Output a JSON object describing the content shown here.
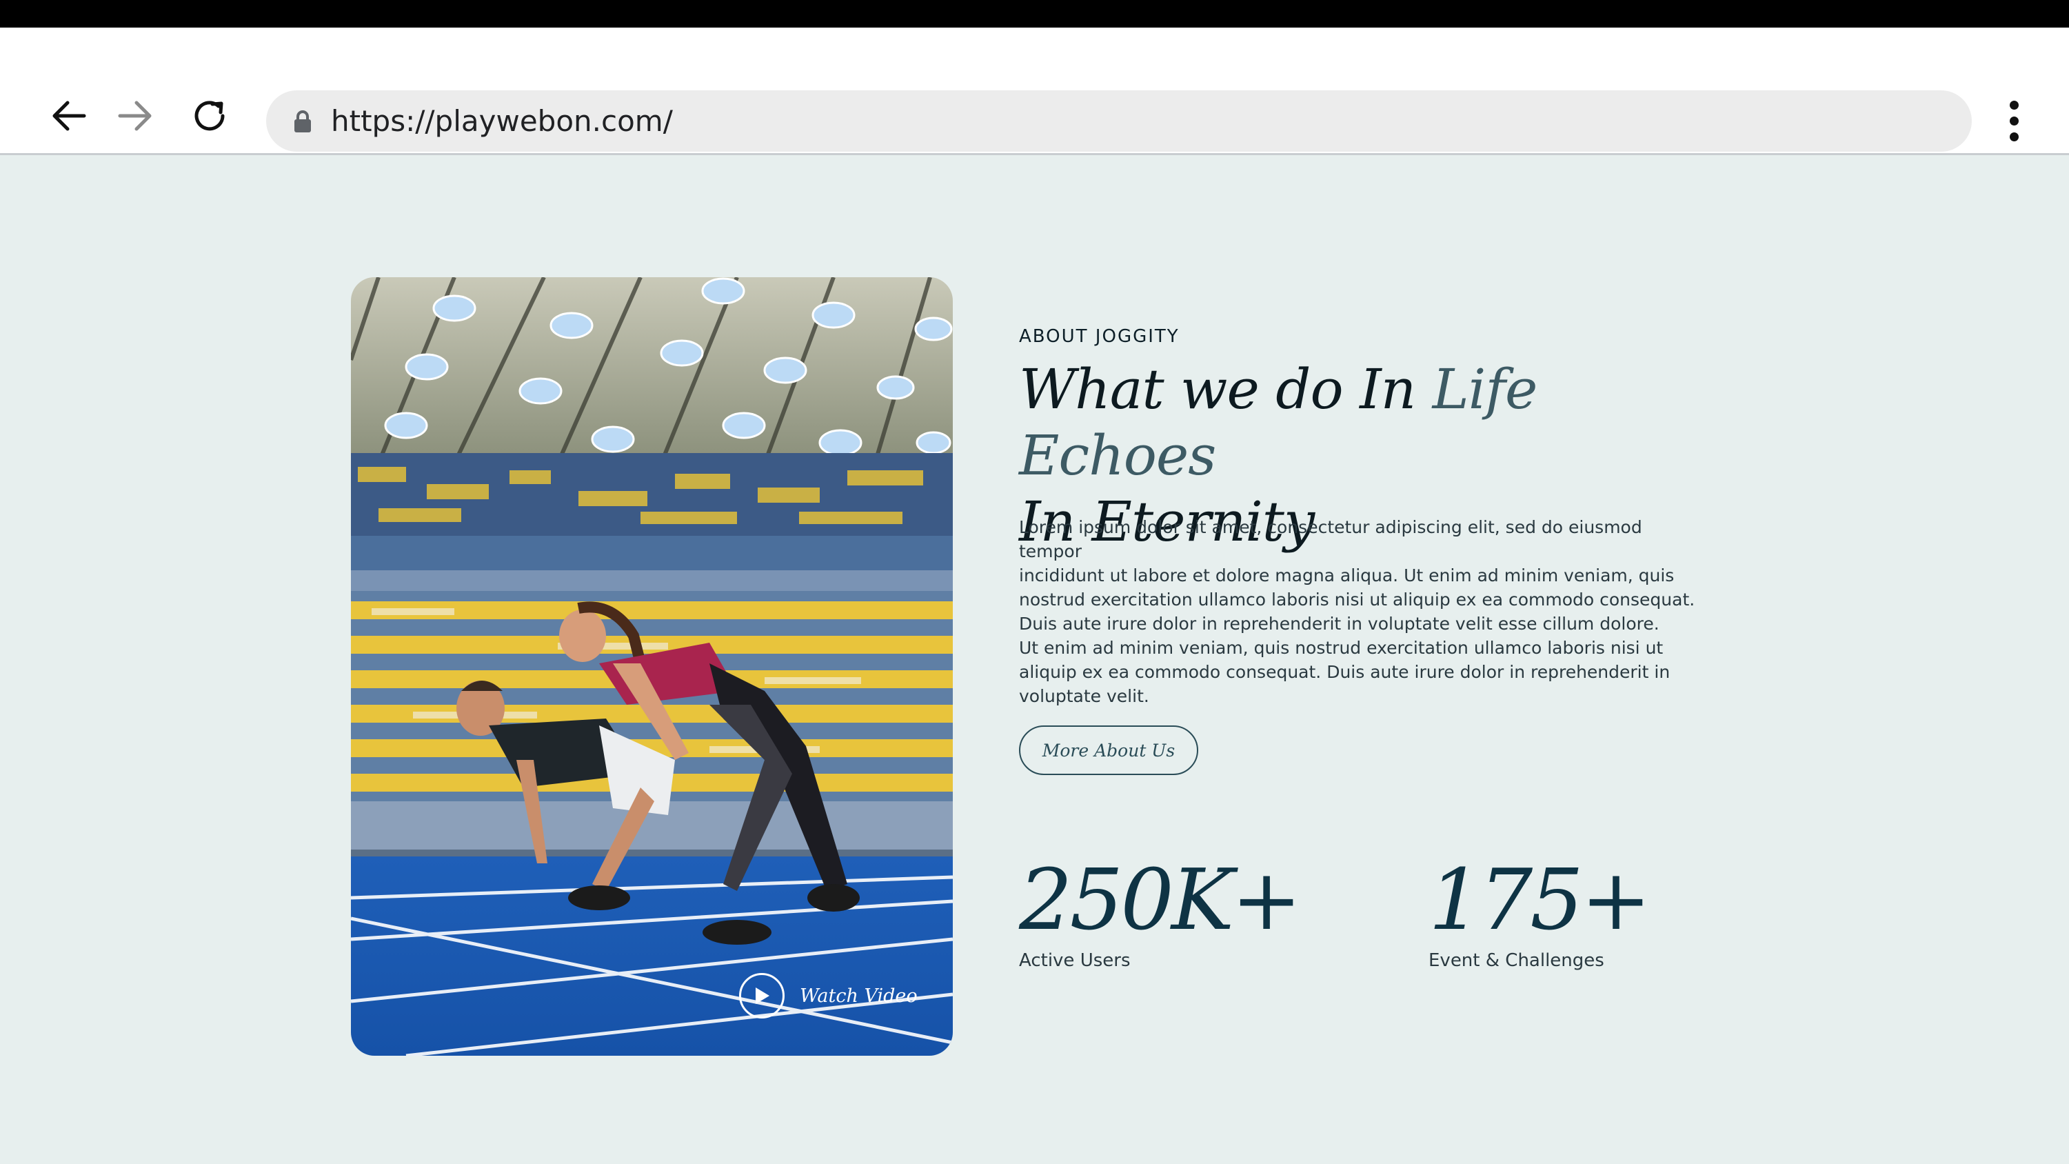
{
  "browser": {
    "url": "https://playwebon.com/",
    "icons": {
      "back": "arrow-left-icon",
      "forward": "arrow-right-icon",
      "reload": "reload-icon",
      "lock": "lock-icon",
      "menu": "kebab-menu-icon"
    }
  },
  "about": {
    "kicker": "ABOUT JOGGITY",
    "headline_part1": "What we do In ",
    "headline_accent": "Life Echoes",
    "headline_part2": "In Eternity",
    "paragraph_lines": [
      "Lorem ipsum dolor sit amet, consectetur adipiscing elit, sed do eiusmod tempor",
      "incididunt ut labore et dolore magna aliqua. Ut enim ad minim veniam, quis",
      "nostrud exercitation ullamco laboris nisi ut aliquip ex ea commodo consequat.",
      "Duis aute irure dolor in reprehenderit in voluptate velit esse cillum dolore.",
      "Ut enim ad minim veniam, quis nostrud exercitation ullamco laboris nisi ut",
      "aliquip ex ea commodo consequat. Duis aute irure dolor in reprehenderit in",
      "voluptate velit."
    ],
    "cta_label": "More About Us",
    "watch_video_label": "Watch Video"
  },
  "stats": [
    {
      "value": "250K+",
      "label": "Active Users"
    },
    {
      "value": "175+",
      "label": "Event & Challenges"
    }
  ],
  "colors": {
    "page_background": "#e7efee",
    "heading": "#0d1a20",
    "accent": "#3d5a64",
    "stat_number": "#0e3344",
    "track_blue": "#1f5fb8"
  }
}
